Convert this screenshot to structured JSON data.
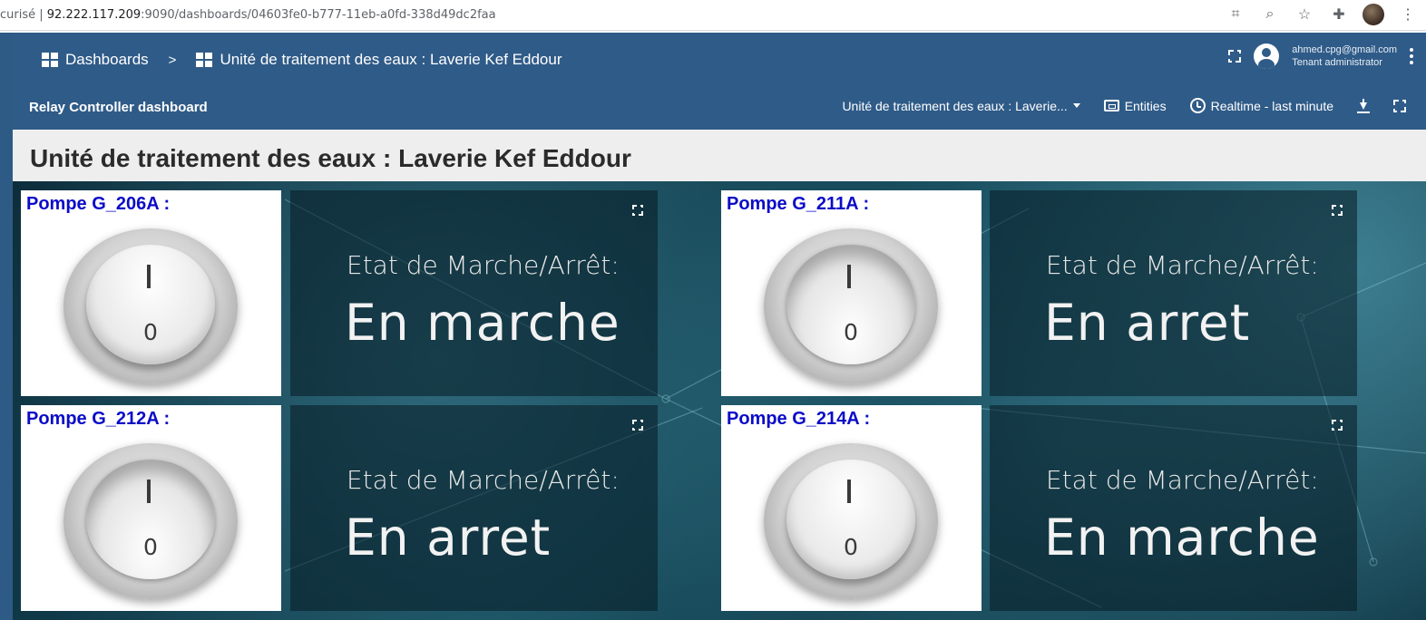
{
  "browser": {
    "address_prefix": "curisé | ",
    "address_host": "92.222.117.209",
    "address_rest": ":9090/dashboards/04603fe0-b777-11eb-a0fd-338d49dc2faa"
  },
  "header": {
    "breadcrumb_root": "Dashboards",
    "breadcrumb_sep": ">",
    "breadcrumb_current": "Unité de traitement des eaux : Laverie Kef Eddour",
    "user_email": "ahmed.cpg@gmail.com",
    "user_role": "Tenant administrator"
  },
  "toolbar": {
    "dashboard_name": "Relay Controller dashboard",
    "entity_selector": "Unité de traitement des eaux : Laverie...",
    "entities_label": "Entities",
    "timewindow_label": "Realtime - last minute"
  },
  "dashboard": {
    "title": "Unité de traitement des eaux : Laverie Kef Eddour"
  },
  "widgets": [
    {
      "pump": "Pompe G_206A :",
      "knob_on_mark": "I",
      "knob_off_mark": "0",
      "switch_on": true,
      "state_label": "Etat de Marche/Arrêt:",
      "state_value": "En marche"
    },
    {
      "pump": "Pompe G_211A :",
      "knob_on_mark": "I",
      "knob_off_mark": "0",
      "switch_on": false,
      "state_label": "Etat de Marche/Arrêt:",
      "state_value": "En arret"
    },
    {
      "pump": "Pompe G_212A :",
      "knob_on_mark": "I",
      "knob_off_mark": "0",
      "switch_on": false,
      "state_label": "Etat de Marche/Arrêt:",
      "state_value": "En arret"
    },
    {
      "pump": "Pompe G_214A :",
      "knob_on_mark": "I",
      "knob_off_mark": "0",
      "switch_on": true,
      "state_label": "Etat de Marche/Arrêt:",
      "state_value": "En marche"
    }
  ],
  "colors": {
    "toolbar_bg": "#2f5b88",
    "pump_label": "#0b0bc8",
    "title_bar_bg": "#eeeeee"
  }
}
